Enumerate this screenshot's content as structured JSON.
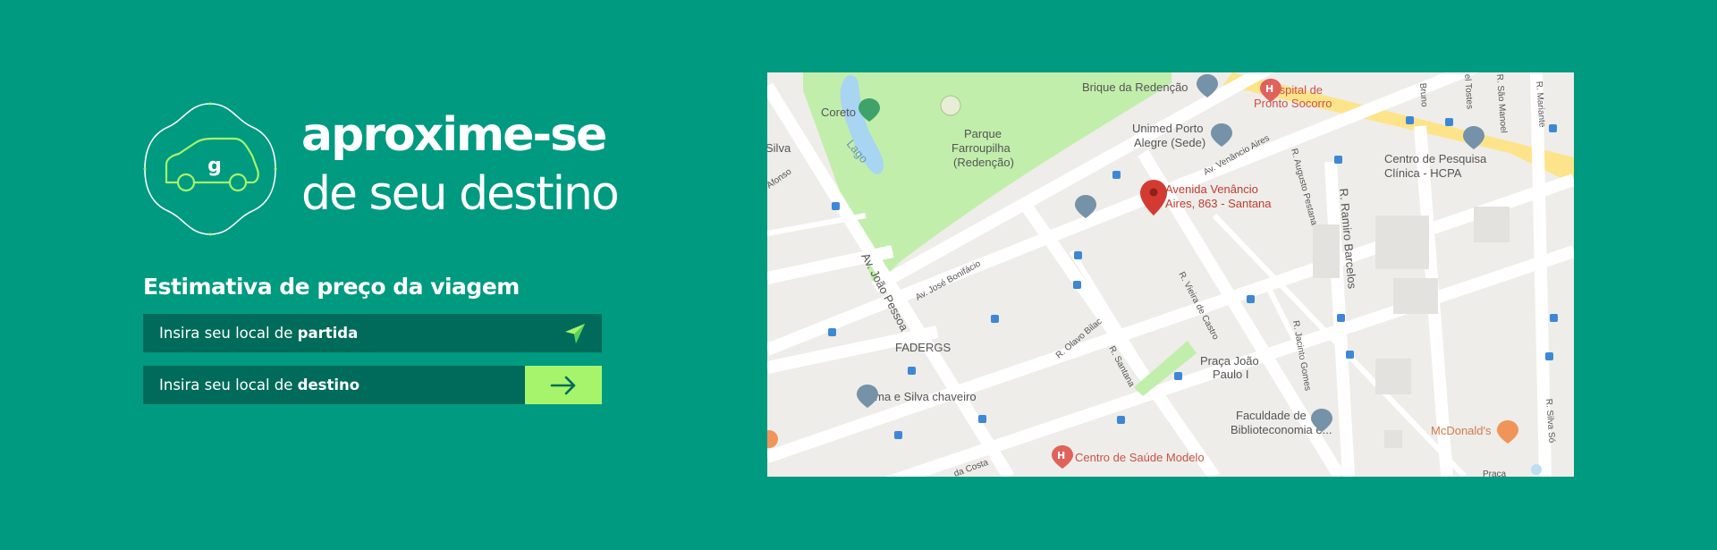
{
  "brand": {
    "headline_line1": "aproxime-se",
    "headline_line2": "de seu destino",
    "logo_icon": "car-logo-icon",
    "logo_letter": "g"
  },
  "estimate": {
    "title": "Estimativa de preço da viagem",
    "origin_prefix": "Insira seu local de ",
    "origin_bold": "partida",
    "origin_icon": "locate-arrow-icon",
    "destination_prefix": "Insira seu local de ",
    "destination_bold": "destino",
    "destination_icon": "arrow-right-icon"
  },
  "map": {
    "marker_label_line1": "Avenida Venâncio",
    "marker_label_line2": "Aires, 863 - Santana",
    "labels": {
      "brique": "Brique da Redenção",
      "hospital1": "Hospital de",
      "hospital2": "Pronto Socorro",
      "coreto": "Coreto",
      "lago": "Lago",
      "parque1": "Parque",
      "parque2": "Farroupilha",
      "parque3": "(Redenção)",
      "unimed1": "Unimed Porto",
      "unimed2": "Alegre (Sede)",
      "centro1": "Centro de Pesquisa",
      "centro2": "Clínica - HCPA",
      "fadergs": "FADERGS",
      "lima": "Lima e Silva chaveiro",
      "praca1": "Praça João",
      "praca2": "Paulo I",
      "faculdade1": "Faculdade de",
      "faculdade2": "Biblioteconomia e...",
      "mcdonalds": "McDonald's",
      "saude": "Centro de Saúde Modelo",
      "silva": "Silva",
      "afonso": "Afonso",
      "joao_pessoa": "Av. João Pessoa",
      "jose_bonifacio": "Av. José Bonifácio",
      "venancio": "Av. Venâncio Aires",
      "augusto": "R. Augusto Pestana",
      "ramiro": "R. Ramiro Barcelos",
      "vieira": "R. Vieira de Castro",
      "olavo": "R. Olavo Bilac",
      "santana": "R. Santana",
      "jacinto": "R. Jacinto Gomes",
      "silva_so": "R. Silva Só",
      "mariante": "R. Mariante",
      "sao_manoel": "R. São Manoel",
      "tostes": "el Tostes",
      "bruno": "Bruno",
      "costa": "da Costa",
      "praca_small": "Praça"
    }
  },
  "colors": {
    "background": "#009a80",
    "field": "#006b5a",
    "accent": "#a6f46c"
  }
}
